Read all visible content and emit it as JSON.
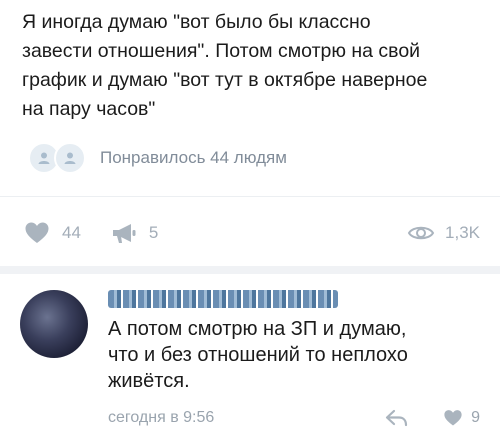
{
  "post": {
    "text": "Я иногда думаю \"вот было бы классно\nзавести отношения\". Потом смотрю на свой\nграфик и думаю \"вот тут в октябре наверное\nна пару часов\""
  },
  "likers": {
    "text": "Понравилось 44 людям"
  },
  "actions": {
    "likes": "44",
    "shares": "5",
    "views": "1,3K"
  },
  "comment": {
    "text": "А потом смотрю на ЗП и думаю,\nчто и без отношений то неплохо\nживётся.",
    "time": "сегодня в 9:56",
    "likes": "9"
  },
  "colors": {
    "text": "#1b1b1b",
    "muted": "#a3adb8",
    "link": "#5b81a8"
  }
}
